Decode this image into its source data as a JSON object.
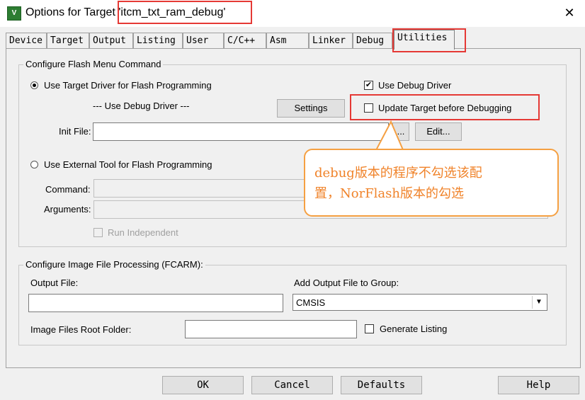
{
  "window": {
    "title_prefix": "Options for Target",
    "title_target": "'itcm_txt_ram_debug'",
    "app_icon_glyph": "V",
    "close_glyph": "✕"
  },
  "tabs": [
    "Device",
    "Target",
    "Output",
    "Listing",
    "User",
    "C/C++",
    "Asm",
    "Linker",
    "Debug",
    "Utilities"
  ],
  "active_tab": "Utilities",
  "flash_menu": {
    "legend": "Configure Flash Menu Command",
    "use_target_driver_label": "Use Target Driver for Flash Programming",
    "use_target_driver_selected": true,
    "use_debug_driver_label": "Use Debug Driver",
    "use_debug_driver_checked": true,
    "driver_dropdown_text": "--- Use Debug Driver ---",
    "settings_button": "Settings",
    "update_target_label": "Update Target before Debugging",
    "update_target_checked": false,
    "init_file_label": "Init File:",
    "init_file_value": "",
    "browse_button": "...",
    "edit_button": "Edit...",
    "use_external_tool_label": "Use External Tool for Flash Programming",
    "use_external_tool_selected": false,
    "command_label": "Command:",
    "command_value": "",
    "arguments_label": "Arguments:",
    "arguments_value": "",
    "run_independent_label": "Run Independent",
    "run_independent_checked": false
  },
  "callout": {
    "line1": "debug版本的程序不勾选该配",
    "line2": "置，NorFlash版本的勾选"
  },
  "image_processing": {
    "legend": "Configure Image File Processing (FCARM):",
    "output_file_label": "Output File:",
    "output_file_value": "",
    "add_output_label": "Add Output File  to Group:",
    "group_selected": "CMSIS",
    "root_folder_label": "Image Files Root Folder:",
    "root_folder_value": "",
    "generate_listing_label": "Generate Listing",
    "generate_listing_checked": false
  },
  "buttons": {
    "ok": "OK",
    "cancel": "Cancel",
    "defaults": "Defaults",
    "help": "Help"
  },
  "colors": {
    "highlight_red": "#e53935",
    "callout_orange": "#f0832a"
  }
}
